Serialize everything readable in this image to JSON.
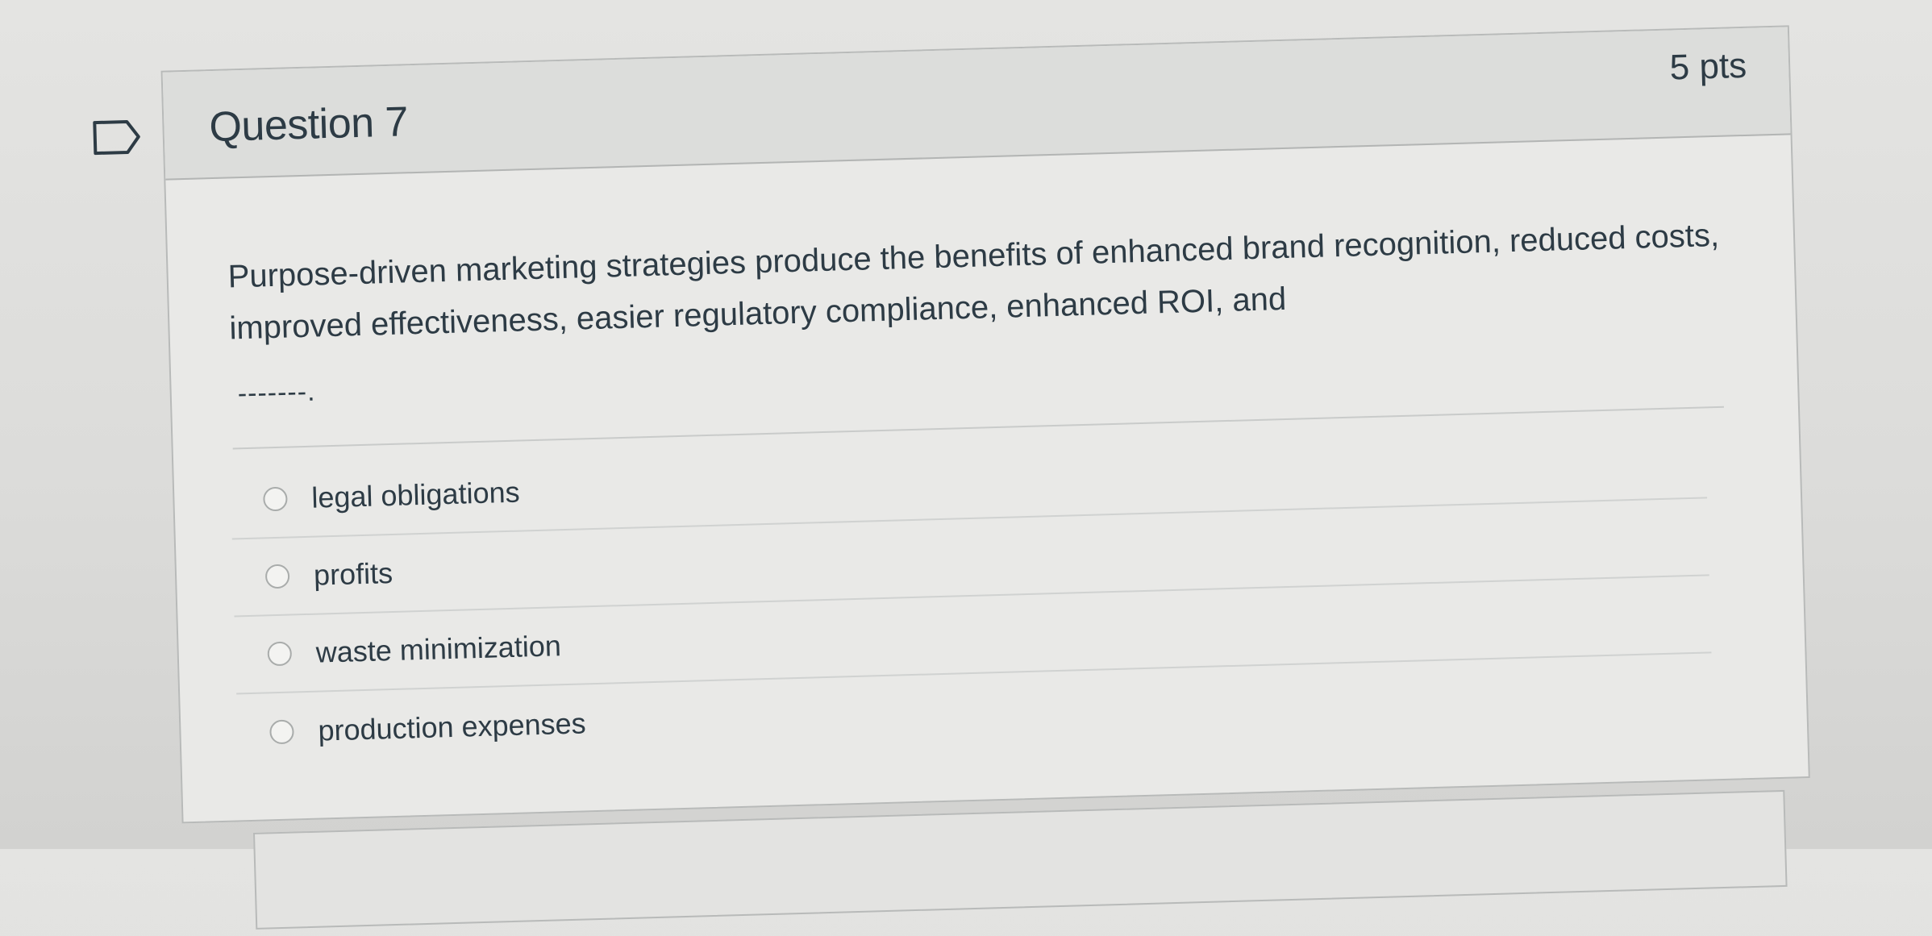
{
  "question": {
    "title": "Question 7",
    "points": "5 pts",
    "text": "Purpose-driven marketing strategies produce the benefits of enhanced brand recognition, reduced costs, improved effectiveness, easier regulatory compliance, enhanced ROI, and",
    "blank": "-------."
  },
  "answers": [
    {
      "label": "legal obligations",
      "selected": false
    },
    {
      "label": "profits",
      "selected": false
    },
    {
      "label": "waste minimization",
      "selected": false
    },
    {
      "label": "production expenses",
      "selected": false
    }
  ],
  "icons": {
    "flag": "flag-question-icon",
    "radio": "radio-unchecked-icon"
  },
  "colors": {
    "text": "#2d3b45",
    "border": "#b8bab9"
  }
}
